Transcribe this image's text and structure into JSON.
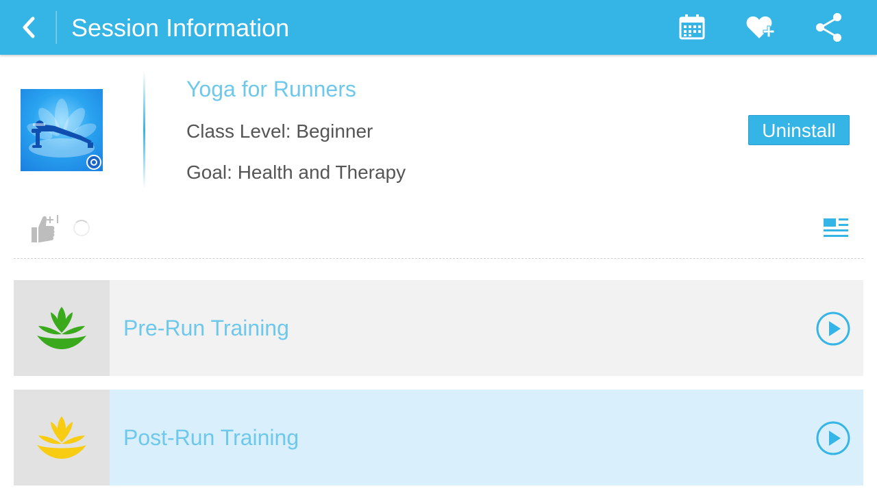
{
  "header": {
    "title": "Session Information",
    "back_icon": "chevron-left-icon",
    "actions": [
      "calendar-icon",
      "heart-plus-icon",
      "share-icon"
    ],
    "background": "#35b5e6"
  },
  "session": {
    "title": "Yoga for Runners",
    "class_level": "Class Level: Beginner",
    "goal": "Health and Therapy",
    "goal_text": "Goal: Health and Therapy",
    "uninstall_label": "Uninstall",
    "like_icon": "thumbs-up-plus-one-icon",
    "list_icon": "list-view-icon"
  },
  "trainings": [
    {
      "label": "Pre-Run Training",
      "icon": "lotus-green-icon",
      "accent": "#3aa91c",
      "background": "#f2f2f2"
    },
    {
      "label": "Post-Run Training",
      "icon": "lotus-yellow-icon",
      "accent": "#f7cc12",
      "background": "#d9f0fc"
    }
  ],
  "colors": {
    "accent": "#35b5e6",
    "title_text": "#6ec8ec",
    "body_text": "#555555"
  }
}
